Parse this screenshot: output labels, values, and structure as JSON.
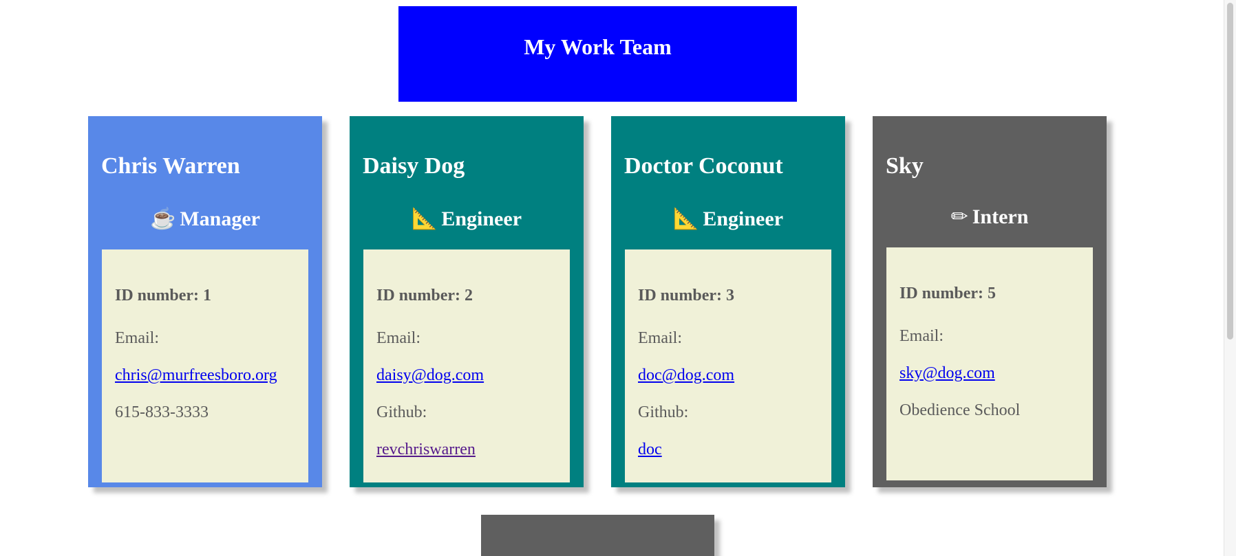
{
  "header": {
    "title": "My Work Team",
    "color": "#0000ff"
  },
  "cards": [
    {
      "name": "Chris Warren",
      "role_icon": "☕",
      "role_icon_name": "coffee-icon",
      "role": "Manager",
      "color": "#5888e8",
      "id_line": "ID number: 1",
      "email_label": "Email:",
      "email": "chris@murfreesboro.org",
      "extra": "615-833-3333"
    },
    {
      "name": "Daisy Dog",
      "role_icon": "📐",
      "role_icon_name": "triangular-ruler-icon",
      "role": "Engineer",
      "color": "#008080",
      "id_line": "ID number: 2",
      "email_label": "Email:",
      "email": "daisy@dog.com",
      "github_label": "Github:",
      "github": "revchriswarren"
    },
    {
      "name": "Doctor Coconut",
      "role_icon": "📐",
      "role_icon_name": "triangular-ruler-icon",
      "role": "Engineer",
      "color": "#008080",
      "id_line": "ID number: 3",
      "email_label": "Email:",
      "email": "doc@dog.com",
      "github_label": "Github:",
      "github": "doc"
    },
    {
      "name": "Sky",
      "role_icon": "✏",
      "role_icon_name": "pencil-icon",
      "role": "Intern",
      "color": "#5f5f5f",
      "id_line": "ID number: 5",
      "email_label": "Email:",
      "email": "sky@dog.com",
      "extra": "Obedience School"
    }
  ],
  "info_background": "#f0f1d8"
}
